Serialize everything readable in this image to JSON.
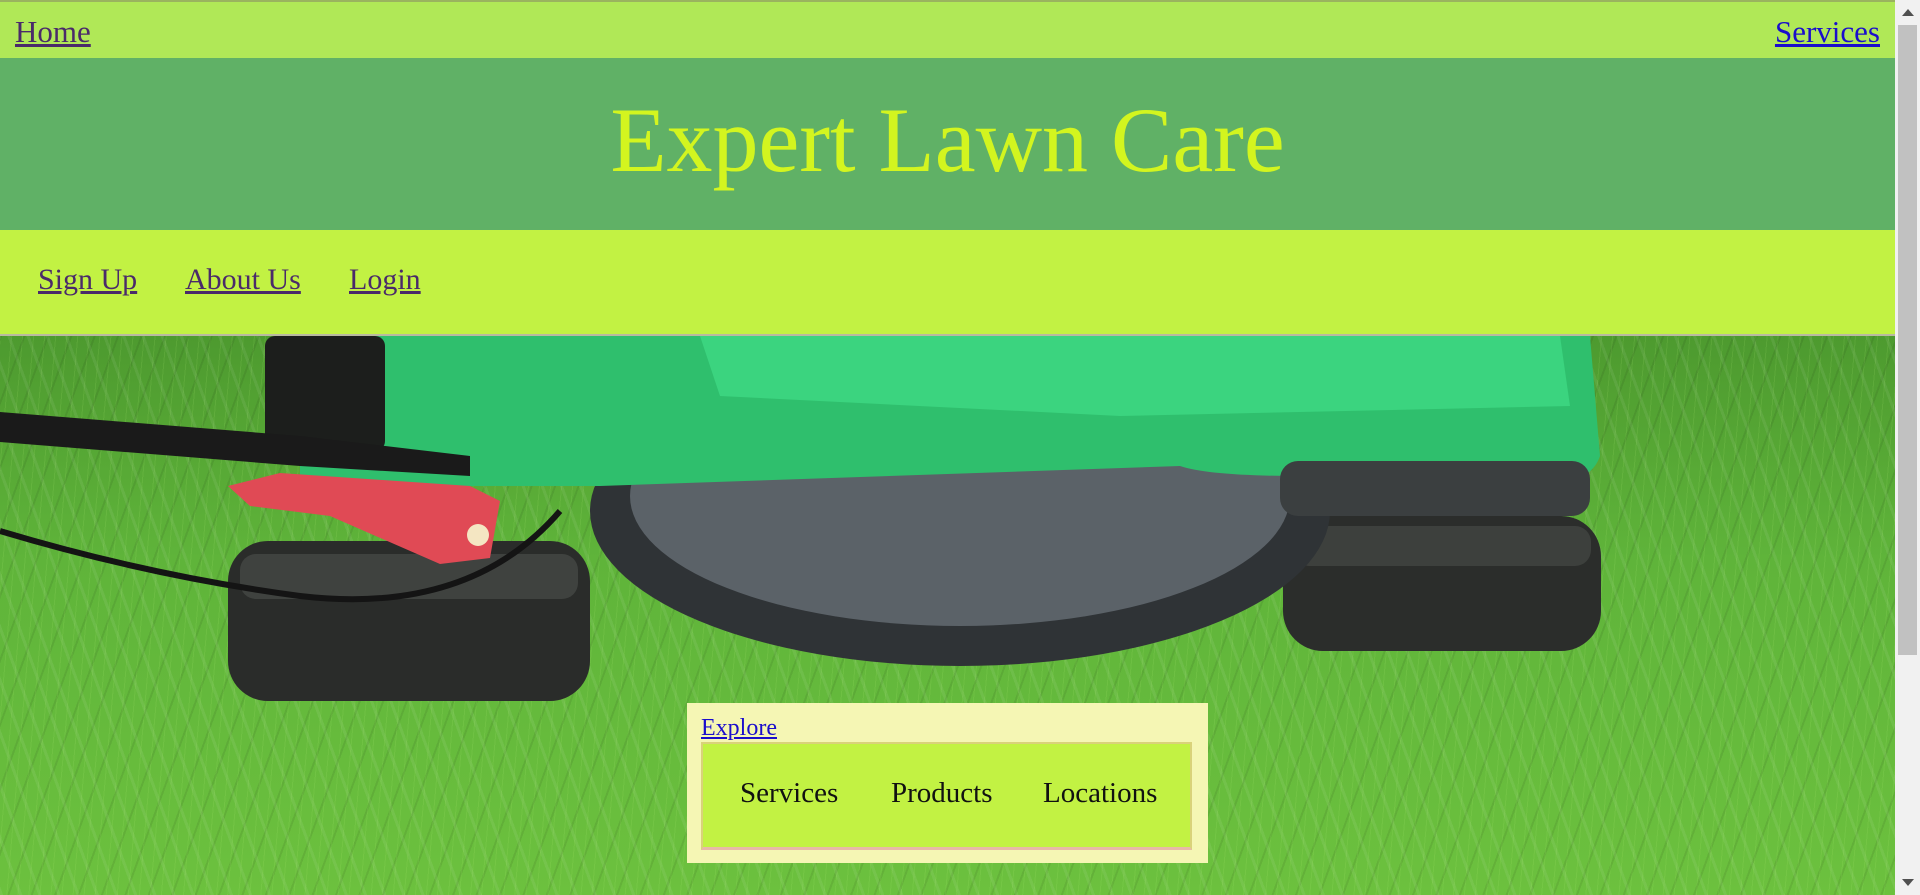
{
  "topbar": {
    "home_label": "Home",
    "services_label": "Services"
  },
  "header": {
    "title": "Expert Lawn Care"
  },
  "subnav": {
    "items": [
      "Sign Up",
      "About Us",
      "Login"
    ]
  },
  "explore": {
    "link_label": "Explore",
    "menu": [
      "Services",
      "Products",
      "Locations"
    ]
  },
  "colors": {
    "topbar_bg": "#b0e857",
    "header_bg": "#60b166",
    "title_color": "#d3f51f",
    "subnav_bg": "#c2f243",
    "explore_box_bg": "#f5f6b4",
    "link_color": "#1a0dcc",
    "visited_link_color": "#4a2a6a"
  },
  "icons": {
    "scroll_up": "scroll-up-arrow-icon",
    "scroll_down": "scroll-down-arrow-icon"
  }
}
